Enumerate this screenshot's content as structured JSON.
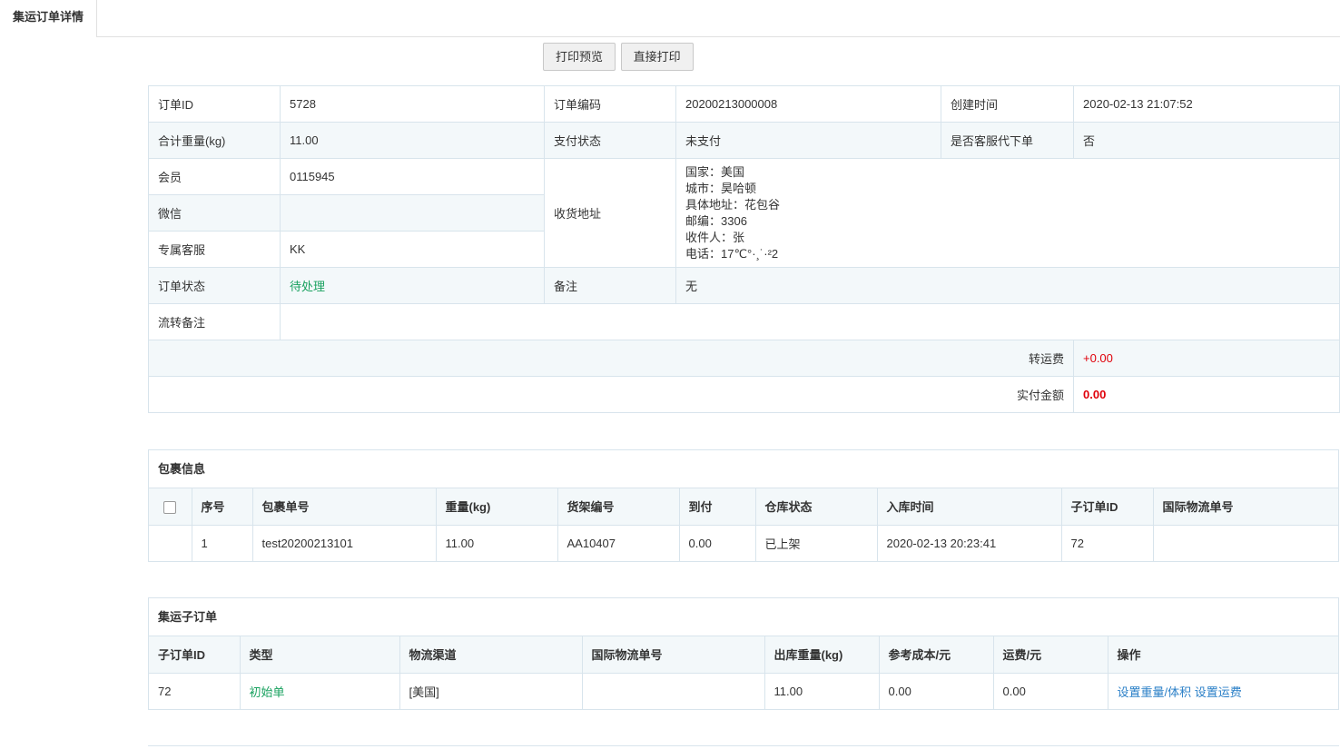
{
  "tab": {
    "title": "集运订单详情"
  },
  "toolbar": {
    "print_preview": "打印预览",
    "direct_print": "直接打印"
  },
  "order": {
    "id_label": "订单ID",
    "id_value": "5728",
    "code_label": "订单编码",
    "code_value": "20200213000008",
    "created_label": "创建时间",
    "created_value": "2020-02-13 21:07:52",
    "weight_label": "合计重量(kg)",
    "weight_value": "11.00",
    "pay_status_label": "支付状态",
    "pay_status_value": "未支付",
    "proxy_label": "是否客服代下单",
    "proxy_value": "否",
    "member_label": "会员",
    "member_value": "0115945",
    "address_label": "收货地址",
    "address_lines": [
      "国家：美国",
      "城市：昊哈顿",
      "具体地址：花包谷",
      "邮编：3306",
      "收件人：张",
      "电话：17℃°·¸˙·²2"
    ],
    "wechat_label": "微信",
    "wechat_value": "",
    "service_label": "专属客服",
    "service_value": "KK",
    "status_label": "订单状态",
    "status_value": "待处理",
    "remark_label": "备注",
    "remark_value": "无",
    "flow_remark_label": "流转备注",
    "flow_remark_value": "",
    "transfer_fee_label": "转运费",
    "transfer_fee_value": "+0.00",
    "paid_label": "实付金额",
    "paid_value": "0.00"
  },
  "packages": {
    "title": "包裹信息",
    "headers": [
      "序号",
      "包裹单号",
      "重量(kg)",
      "货架编号",
      "到付",
      "仓库状态",
      "入库时间",
      "子订单ID",
      "国际物流单号"
    ],
    "rows": [
      {
        "index": "1",
        "no": "test20200213101",
        "weight": "11.00",
        "shelf": "AA10407",
        "cod": "0.00",
        "status": "已上架",
        "in_time": "2020-02-13 20:23:41",
        "sub_id": "72",
        "intl_no": ""
      }
    ]
  },
  "suborders": {
    "title": "集运子订单",
    "headers": [
      "子订单ID",
      "类型",
      "物流渠道",
      "国际物流单号",
      "出库重量(kg)",
      "参考成本/元",
      "运费/元",
      "操作"
    ],
    "rows": [
      {
        "id": "72",
        "type": "初始单",
        "channel": "[美国]",
        "intl_no": "",
        "out_weight": "11.00",
        "cost": "0.00",
        "freight": "0.00",
        "action_weight": "设置重量/体积",
        "action_freight": "设置运费"
      }
    ]
  },
  "colors": {
    "green": "#19a15f",
    "red": "#e0000a",
    "link": "#2a7fc7",
    "border": "#d8e4ec",
    "zebra": "#f3f8fa"
  }
}
